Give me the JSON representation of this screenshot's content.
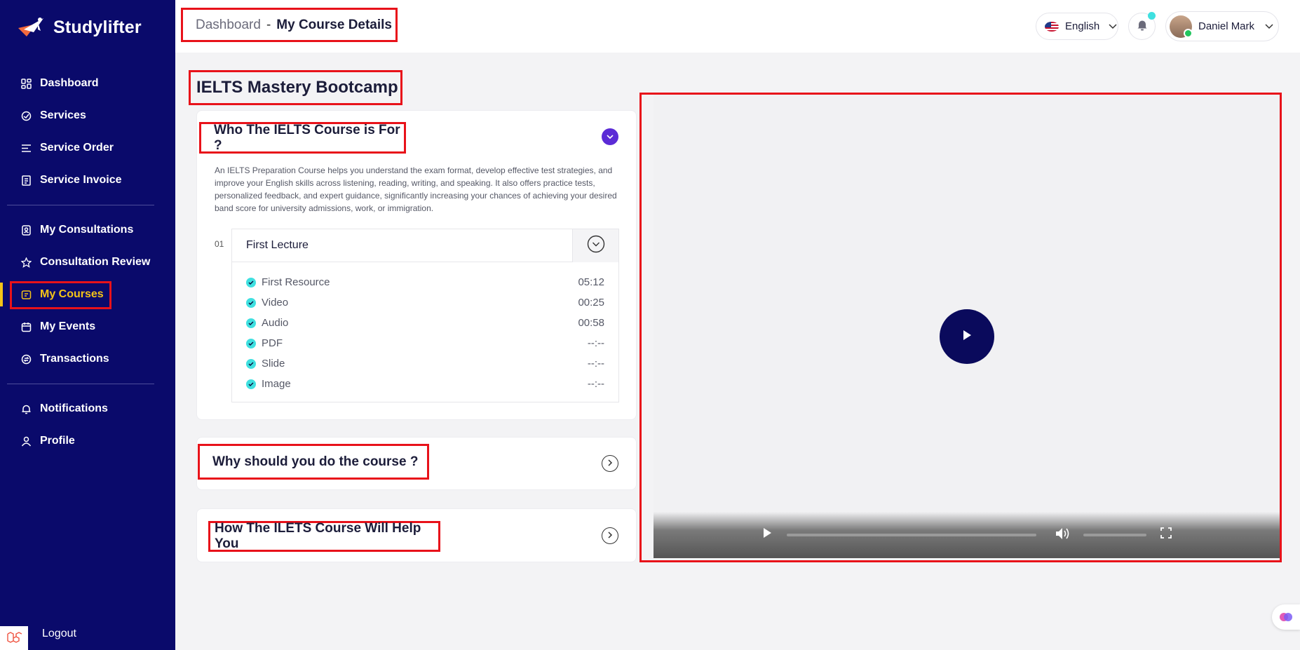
{
  "app": {
    "name": "Studylifter"
  },
  "sidebar": {
    "groups": [
      {
        "items": [
          {
            "label": "Dashboard",
            "icon": "dashboard-icon"
          },
          {
            "label": "Services",
            "icon": "services-icon"
          },
          {
            "label": "Service Order",
            "icon": "service-order-icon"
          },
          {
            "label": "Service Invoice",
            "icon": "invoice-icon"
          }
        ]
      },
      {
        "items": [
          {
            "label": "My Consultations",
            "icon": "consultations-icon"
          },
          {
            "label": "Consultation Review",
            "icon": "star-icon"
          },
          {
            "label": "My Courses",
            "icon": "courses-icon",
            "active": true
          },
          {
            "label": "My Events",
            "icon": "calendar-icon"
          },
          {
            "label": "Transactions",
            "icon": "transactions-icon"
          }
        ]
      },
      {
        "items": [
          {
            "label": "Notifications",
            "icon": "bell-icon"
          },
          {
            "label": "Profile",
            "icon": "user-icon"
          }
        ]
      }
    ],
    "logout": "Logout"
  },
  "header": {
    "breadcrumb": {
      "root": "Dashboard",
      "separator": "-",
      "current": "My Course Details"
    },
    "language": "English",
    "user_name": "Daniel Mark"
  },
  "course": {
    "title": "IELTS Mastery Bootcamp",
    "sections": [
      {
        "title": "Who The IELTS Course is For ?",
        "expanded": true,
        "description": "An IELTS Preparation Course helps you understand the exam format, develop effective test strategies, and improve your English skills across listening, reading, writing, and speaking. It also offers practice tests, personalized feedback, and expert guidance, significantly increasing your chances of achieving your desired band score for university admissions, work, or immigration.",
        "lectures": [
          {
            "number": "01",
            "title": "First Lecture",
            "resources": [
              {
                "name": "First Resource",
                "duration": "05:12"
              },
              {
                "name": "Video",
                "duration": "00:25"
              },
              {
                "name": "Audio",
                "duration": "00:58"
              },
              {
                "name": "PDF",
                "duration": "--:--"
              },
              {
                "name": "Slide",
                "duration": "--:--"
              },
              {
                "name": "Image",
                "duration": "--:--"
              }
            ]
          }
        ]
      },
      {
        "title": "Why should you do the course ?",
        "expanded": false
      },
      {
        "title": "How The ILETS Course Will Help You",
        "expanded": false
      }
    ]
  },
  "colors": {
    "sidebar_bg": "#0a0a6b",
    "active_nav": "#f5c418",
    "highlight_box": "#e8121a",
    "accent_purple": "#5b2bd6",
    "check_cyan": "#3fe0e0",
    "play_button": "#0a0a5c"
  }
}
